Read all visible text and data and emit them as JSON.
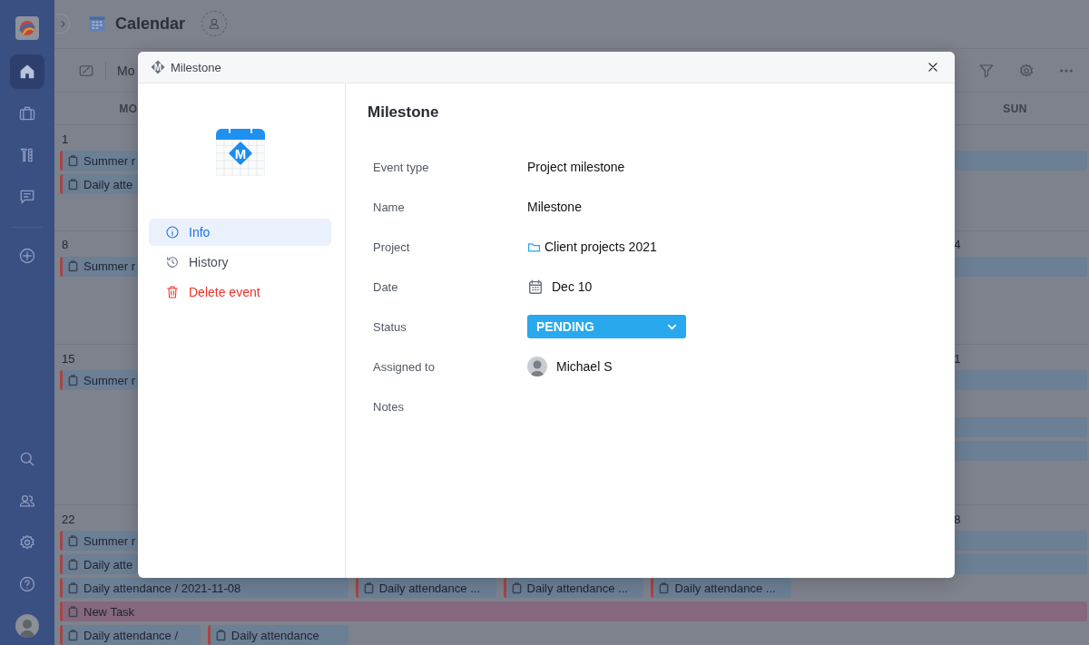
{
  "sidebar": {
    "items": [
      {
        "selected": true
      },
      {
        "selected": false
      },
      {
        "selected": false
      },
      {
        "selected": false
      },
      {
        "selected": false
      }
    ]
  },
  "header": {
    "title": "Calendar"
  },
  "toolbar": {
    "view_label": "Mo"
  },
  "weekdays": [
    {
      "label": "MO",
      "kind": "mon"
    },
    {
      "label": "SUN",
      "kind": "sun"
    }
  ],
  "weeks": [
    {
      "day_numbers": [
        {
          "text": "1",
          "kind": "mon"
        }
      ],
      "lanes": [
        {
          "events": [
            {
              "text": "Summer r",
              "kind": "task_week"
            }
          ]
        },
        {
          "events": [
            {
              "text": "Daily atte",
              "kind": "task_day"
            }
          ]
        }
      ]
    },
    {
      "day_numbers": [
        {
          "text": "8",
          "kind": "mon"
        },
        {
          "text": "4",
          "kind": "sun"
        }
      ],
      "lanes": [
        {
          "events": [
            {
              "text": "Summer r",
              "kind": "task_week"
            }
          ]
        }
      ]
    },
    {
      "day_numbers": [
        {
          "text": "15",
          "kind": "mon"
        },
        {
          "text": "1",
          "kind": "sun"
        }
      ],
      "lanes": [
        {
          "events": [
            {
              "text": "Summer r",
              "kind": "task_week"
            }
          ]
        },
        {
          "events": [
            {
              "kind": "gap_week"
            }
          ]
        },
        {
          "events": [
            {
              "kind": "gap_six_days"
            },
            {
              "kind": "task_day"
            }
          ]
        },
        {
          "events": [
            {
              "kind": "gap_six_days"
            },
            {
              "kind": "task_day"
            }
          ]
        }
      ]
    },
    {
      "day_numbers": [
        {
          "text": "22",
          "kind": "mon"
        },
        {
          "text": "8",
          "kind": "sun"
        }
      ],
      "lanes": [
        {
          "events": [
            {
              "text": "Summer r",
              "kind": "task_week"
            }
          ]
        },
        {
          "events": [
            {
              "text": "Daily atte",
              "kind": "task_week"
            }
          ]
        },
        {
          "events": [
            {
              "text": "Daily attendance / 2021-11-08",
              "kind": "task_two_days"
            },
            {
              "text": "Daily attendance ...",
              "kind": "task_day"
            },
            {
              "text": "Daily attendance ...",
              "kind": "task_day"
            },
            {
              "text": "Daily attendance ...",
              "kind": "task_day"
            }
          ]
        },
        {
          "events": [
            {
              "text": "New Task",
              "kind": "new_week"
            }
          ]
        },
        {
          "events": [
            {
              "text": "Daily attendance /",
              "kind": "task_day"
            },
            {
              "text": "Daily attendance",
              "kind": "task_day"
            }
          ]
        }
      ]
    }
  ],
  "dialog": {
    "title": "Milestone",
    "title_icon_letter": "M",
    "badge_letter": "M",
    "menu": [
      {
        "label": "Info",
        "kind": "info",
        "selected": true
      },
      {
        "label": "History",
        "kind": "history",
        "selected": false
      },
      {
        "label": "Delete event",
        "kind": "delete",
        "selected": false
      }
    ],
    "heading": "Milestone",
    "fields": [
      {
        "label": "Event type",
        "value": "Project milestone",
        "kind": "text"
      },
      {
        "label": "Name",
        "value": "Milestone",
        "kind": "text"
      },
      {
        "label": "Project",
        "value": "Client projects 2021",
        "kind": "folder"
      },
      {
        "label": "Date",
        "value": "Dec 10",
        "kind": "date"
      },
      {
        "label": "Status",
        "value": "PENDING",
        "kind": "status"
      },
      {
        "label": "Assigned to",
        "value": "Michael S",
        "kind": "person"
      },
      {
        "label": "Notes"
      }
    ]
  }
}
